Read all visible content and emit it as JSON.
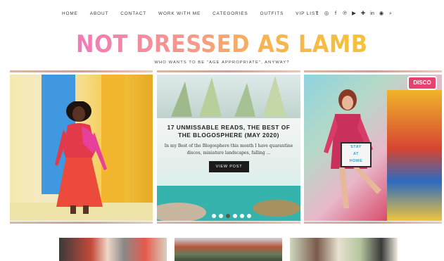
{
  "nav": {
    "items": [
      "HOME",
      "ABOUT",
      "CONTACT",
      "WORK WITH ME",
      "CATEGORIES",
      "OUTFITS",
      "VIP LIST"
    ]
  },
  "social": {
    "icons": [
      "twitter-icon",
      "instagram-icon",
      "facebook-icon",
      "pinterest-icon",
      "youtube-icon",
      "bloglovin-icon",
      "linkedin-icon",
      "rss-icon",
      "search-icon"
    ],
    "glyphs": [
      "𝕥",
      "◎",
      "f",
      "℗",
      "▶",
      "✚",
      "in",
      "◉",
      "⌕"
    ]
  },
  "header": {
    "logo": "NOT DRESSED AS LAMB",
    "tagline": "WHO WANTS TO BE \"AGE APPROPRIATE\", ANYWAY?"
  },
  "slider": {
    "title": "17 UNMISSABLE READS, THE BEST OF THE BLOGOSPHERE (MAY 2020)",
    "excerpt": "In my Best of the Blogosphere this month I have quarantine discos, miniature landscapes, falling ...",
    "button": "VIEW POST",
    "slide_count": 6,
    "active_slide": 3
  },
  "right_panel": {
    "sign_lines": [
      "STAY",
      "AT",
      "HOME"
    ],
    "neon": "DISCO"
  },
  "colors": {
    "logo_gradient_start": "#f07ab7",
    "logo_gradient_end": "#f4c23a",
    "button": "#1b1b1b",
    "rule": "#d9b9a6"
  }
}
